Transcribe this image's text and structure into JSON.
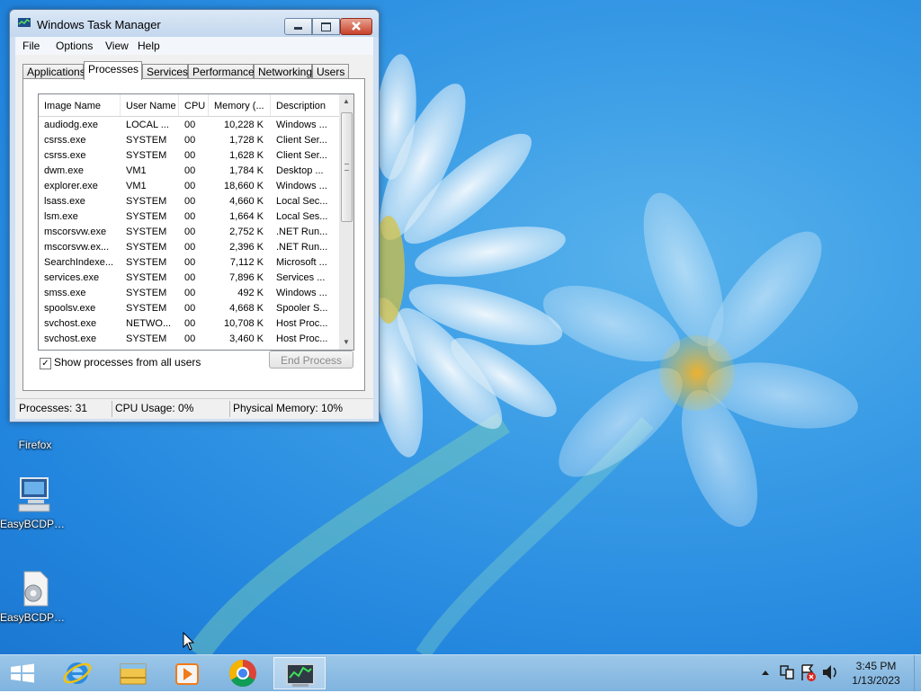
{
  "window": {
    "title": "Windows Task Manager",
    "menu": [
      "File",
      "Options",
      "View",
      "Help"
    ],
    "tabs": [
      "Applications",
      "Processes",
      "Services",
      "Performance",
      "Networking",
      "Users"
    ],
    "active_tab": "Processes",
    "columns": [
      "Image Name",
      "User Name",
      "CPU",
      "Memory (...",
      "Description"
    ],
    "processes": [
      {
        "image": "audiodg.exe",
        "user": "LOCAL ...",
        "cpu": "00",
        "mem": "10,228 K",
        "desc": "Windows ..."
      },
      {
        "image": "csrss.exe",
        "user": "SYSTEM",
        "cpu": "00",
        "mem": "1,728 K",
        "desc": "Client Ser..."
      },
      {
        "image": "csrss.exe",
        "user": "SYSTEM",
        "cpu": "00",
        "mem": "1,628 K",
        "desc": "Client Ser..."
      },
      {
        "image": "dwm.exe",
        "user": "VM1",
        "cpu": "00",
        "mem": "1,784 K",
        "desc": "Desktop ..."
      },
      {
        "image": "explorer.exe",
        "user": "VM1",
        "cpu": "00",
        "mem": "18,660 K",
        "desc": "Windows ..."
      },
      {
        "image": "lsass.exe",
        "user": "SYSTEM",
        "cpu": "00",
        "mem": "4,660 K",
        "desc": "Local Sec..."
      },
      {
        "image": "lsm.exe",
        "user": "SYSTEM",
        "cpu": "00",
        "mem": "1,664 K",
        "desc": "Local Ses..."
      },
      {
        "image": "mscorsvw.exe",
        "user": "SYSTEM",
        "cpu": "00",
        "mem": "2,752 K",
        "desc": ".NET Run..."
      },
      {
        "image": "mscorsvw.ex...",
        "user": "SYSTEM",
        "cpu": "00",
        "mem": "2,396 K",
        "desc": ".NET Run..."
      },
      {
        "image": "SearchIndexe...",
        "user": "SYSTEM",
        "cpu": "00",
        "mem": "7,112 K",
        "desc": "Microsoft ..."
      },
      {
        "image": "services.exe",
        "user": "SYSTEM",
        "cpu": "00",
        "mem": "7,896 K",
        "desc": "Services ..."
      },
      {
        "image": "smss.exe",
        "user": "SYSTEM",
        "cpu": "00",
        "mem": "492 K",
        "desc": "Windows ..."
      },
      {
        "image": "spoolsv.exe",
        "user": "SYSTEM",
        "cpu": "00",
        "mem": "4,668 K",
        "desc": "Spooler S..."
      },
      {
        "image": "svchost.exe",
        "user": "NETWO...",
        "cpu": "00",
        "mem": "10,708 K",
        "desc": "Host Proc..."
      },
      {
        "image": "svchost.exe",
        "user": "SYSTEM",
        "cpu": "00",
        "mem": "3,460 K",
        "desc": "Host Proc..."
      }
    ],
    "show_all_label": "Show processes from all users",
    "show_all_checked": "✓",
    "end_process_label": "End Process",
    "status": {
      "processes": "Processes: 31",
      "cpu": "CPU Usage: 0%",
      "memory": "Physical Memory: 10%"
    }
  },
  "desktop_icons": [
    {
      "label": "Firefox",
      "icon": "firefox-icon"
    },
    {
      "label": "EasyBCDPor...",
      "icon": "computer-icon"
    },
    {
      "label": "EasyBCDPor...",
      "icon": "settings-file-icon"
    }
  ],
  "taskbar": {
    "items": [
      "start-icon",
      "internet-explorer-icon",
      "file-explorer-icon",
      "media-player-icon",
      "chrome-icon",
      "task-manager-icon"
    ],
    "clock_time": "3:45 PM",
    "clock_date": "1/13/2023"
  }
}
